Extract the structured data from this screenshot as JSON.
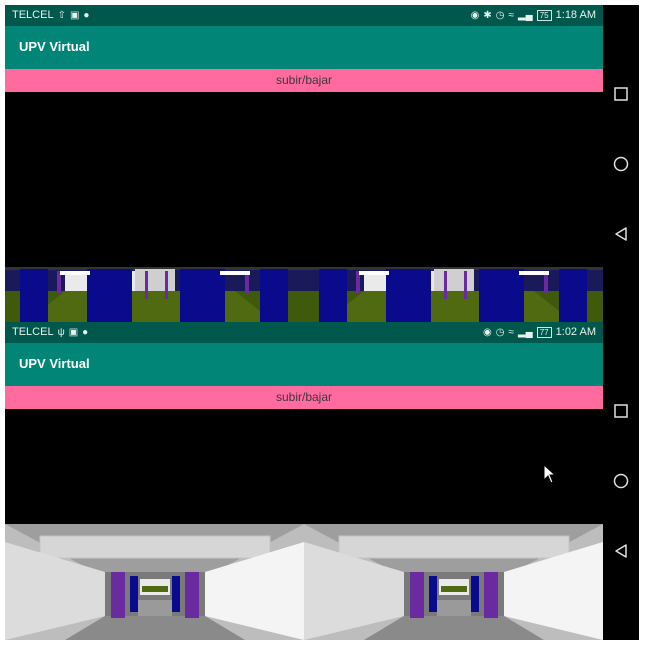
{
  "screens": [
    {
      "status": {
        "carrier": "TELCEL",
        "left_icons": [
          "upload-icon",
          "image-icon",
          "location-icon"
        ],
        "right_icons": [
          "headset-icon",
          "bluetooth-icon",
          "alarm-icon",
          "wifi-icon",
          "signal-icon"
        ],
        "battery": "75",
        "time": "1:18 AM"
      },
      "app_title": "UPV Virtual",
      "action_label": "subir/bajar"
    },
    {
      "status": {
        "carrier": "TELCEL",
        "left_icons": [
          "usb-icon",
          "image-icon",
          "location-icon"
        ],
        "right_icons": [
          "headset-icon",
          "alarm-icon",
          "wifi-icon",
          "signal-icon"
        ],
        "battery": "77",
        "time": "1:02 AM"
      },
      "app_title": "UPV Virtual",
      "action_label": "subir/bajar"
    }
  ],
  "nav_buttons": [
    "recents-icon",
    "home-icon",
    "back-icon"
  ],
  "colors": {
    "status_bar": "#00574b",
    "app_bar": "#008577",
    "action_button": "#ff6b9f",
    "pillar_blue": "#0a0a8c",
    "pillar_purple": "#6a2aa0",
    "floor_green": "#4f6a10"
  }
}
